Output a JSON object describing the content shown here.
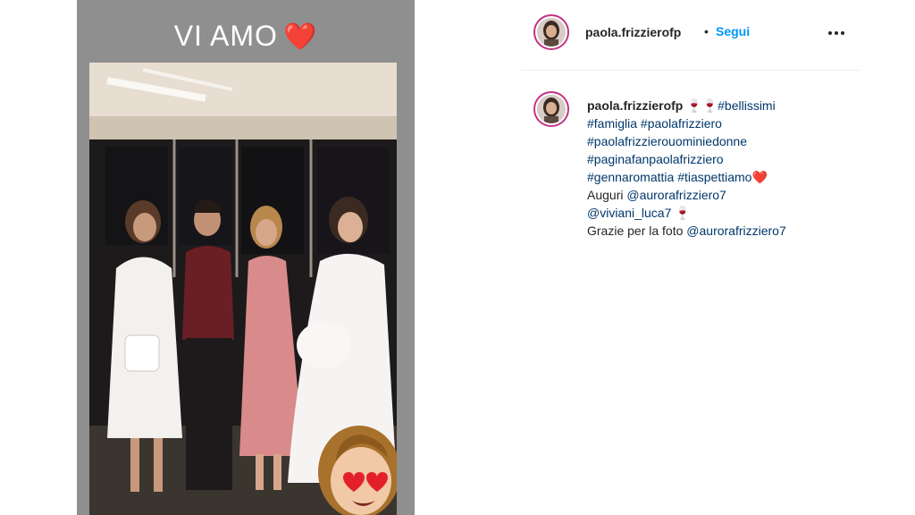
{
  "story": {
    "caption": "VI AMO",
    "caption_emoji": "❤️"
  },
  "header": {
    "username": "paola.frizzierofp",
    "separator": "•",
    "follow_label": "Segui",
    "more_icon": "more-horizontal-icon"
  },
  "caption": {
    "username": "paola.frizzierofp",
    "line1_prefix": "🍷🍷",
    "line1_tag": "#bellissimi",
    "line2_tag1": "#famiglia",
    "line2_tag2": "#paolafrizziero",
    "line3_tag": "#paolafrizzierouominiedonne",
    "line4_tag": "#paginafanpaolafrizziero",
    "line5_tag1": "#gennaromattia",
    "line5_tag2": "#tiaspettiamo",
    "line5_emoji": "❤️",
    "line6_text": "Auguri",
    "line6_mention": "@aurorafrizziero7",
    "line7_mention": "@viviani_luca7",
    "line7_emoji": "🍷",
    "line8_text": "Grazie per la foto",
    "line8_mention": "@aurorafrizziero7"
  },
  "colors": {
    "follow": "#0095f6",
    "hashtag": "#00376b",
    "story_ring": "#c13584"
  }
}
